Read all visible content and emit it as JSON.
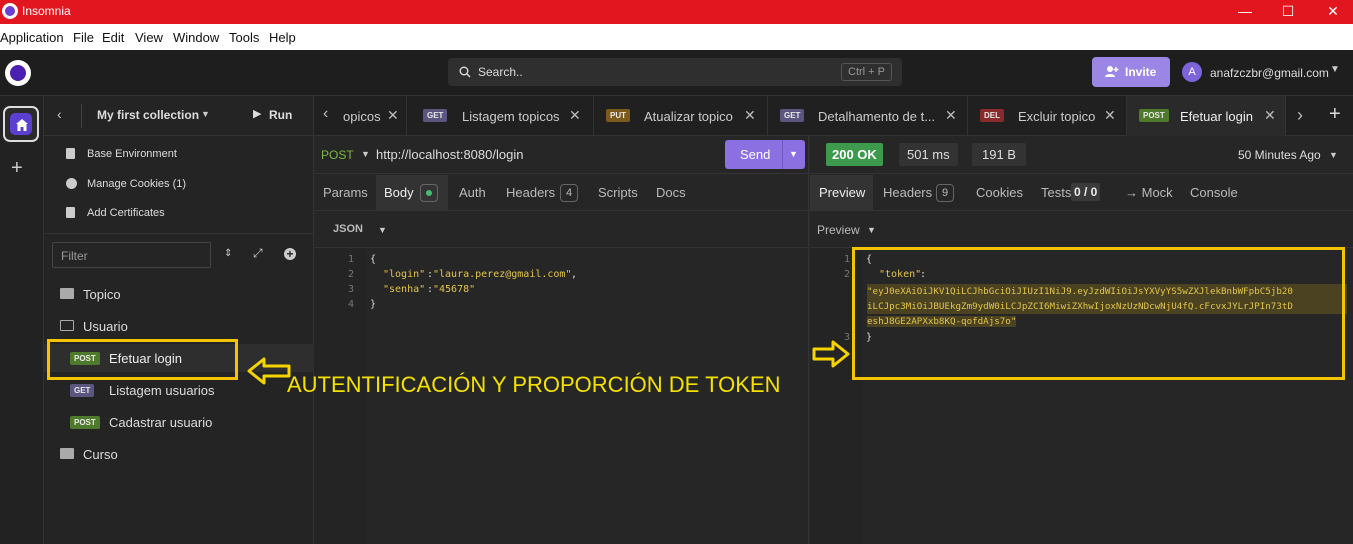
{
  "window": {
    "title": "Insomnia",
    "minimize": "—",
    "maximize": "☐",
    "close": "✕"
  },
  "menu": [
    "Application",
    "File",
    "Edit",
    "View",
    "Window",
    "Tools",
    "Help"
  ],
  "header": {
    "search_placeholder": "Search..",
    "search_shortcut": "Ctrl + P",
    "invite_label": "Invite",
    "avatar_initial": "A",
    "user_email": "anafzczbr@gmail.com"
  },
  "sidebar": {
    "back_icon": "chevron-left-icon",
    "collection_name": "My first collection",
    "run_label": "Run",
    "actions": [
      {
        "label": "Base Environment",
        "icon": "file-icon"
      },
      {
        "label": "Manage Cookies (1)",
        "icon": "cookie-icon"
      },
      {
        "label": "Add Certificates",
        "icon": "certificate-icon"
      }
    ],
    "filter_placeholder": "Filter",
    "tree": [
      {
        "type": "folder",
        "label": "Topico",
        "depth": 0
      },
      {
        "type": "folder",
        "label": "Usuario",
        "depth": 0,
        "open": true
      },
      {
        "type": "request",
        "method": "POST",
        "label": "Efetuar login",
        "depth": 1,
        "active": true
      },
      {
        "type": "request",
        "method": "GET",
        "label": "Listagem usuarios",
        "depth": 1
      },
      {
        "type": "request",
        "method": "POST",
        "label": "Cadastrar usuario",
        "depth": 1
      },
      {
        "type": "folder",
        "label": "Curso",
        "depth": 0
      }
    ]
  },
  "tabs": [
    {
      "label": "opicos",
      "method": ""
    },
    {
      "label": "Listagem topicos",
      "method": "GET"
    },
    {
      "label": "Atualizar topico",
      "method": "PUT"
    },
    {
      "label": "Detalhamento de t...",
      "method": "GET"
    },
    {
      "label": "Excluir topico",
      "method": "DEL"
    },
    {
      "label": "Efetuar login",
      "method": "POST",
      "active": true
    }
  ],
  "request": {
    "method": "POST",
    "url": "http://localhost:8080/login",
    "send_label": "Send",
    "subtabs": [
      "Params",
      "Body",
      "Auth",
      "Headers",
      "Scripts",
      "Docs"
    ],
    "headers_count": "4",
    "body_type": "JSON",
    "body_lines": [
      {
        "n": "1",
        "text": "{"
      },
      {
        "n": "2",
        "key": "\"login\"",
        "value": "\"laura.perez@gmail.com\"",
        "comma": ","
      },
      {
        "n": "3",
        "key": "\"senha\"",
        "value": "\"45678\"",
        "comma": ""
      },
      {
        "n": "4",
        "text": "}"
      }
    ]
  },
  "response": {
    "status": "200 OK",
    "time": "501 ms",
    "size": "191 B",
    "age": "50 Minutes Ago",
    "subtabs": [
      "Preview",
      "Headers",
      "Cookies",
      "Tests",
      "→ Mock",
      "Console"
    ],
    "headers_count": "9",
    "tests_count": "0 / 0",
    "preview_mode": "Preview",
    "lines": [
      {
        "n": "1",
        "text": "{"
      },
      {
        "n": "2",
        "key": "\"token\"",
        "text": ":"
      },
      {
        "n": "",
        "token_lines": [
          "\"eyJ0eXAiOiJKV1QiLCJhbGciOiJIUzI1NiJ9.eyJzdWIiOiJsYXVyYS5wZXJlekBnbWFpbC5jb20",
          "iLCJpc3MiOiJBUEkgZm9ydW0iLCJpZCI6MiwiZXhwIjoxNzUzNDcwNjU4fQ.cFcvxJYLrJPIn73tD",
          "eshJ8GE2APXxb8KQ-qofdAjs7o\""
        ]
      },
      {
        "n": "3",
        "text": "}"
      }
    ]
  },
  "annotation": {
    "text": "AUTENTIFICACIÓN Y PROPORCIÓN DE TOKEN",
    "color": "#f5e100"
  }
}
